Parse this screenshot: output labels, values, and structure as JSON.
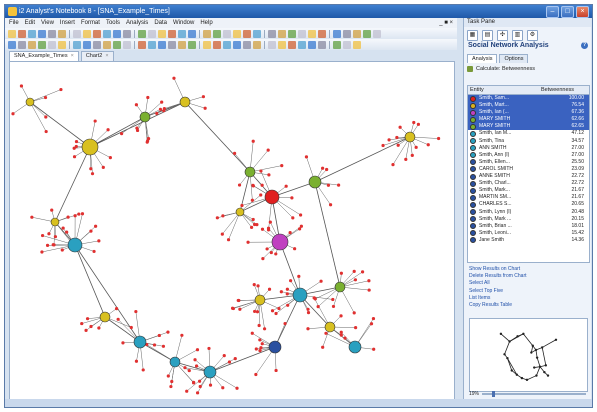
{
  "window": {
    "title": "i2 Analyst's Notebook 8 - [SNA_Example_Times]"
  },
  "menu": [
    "File",
    "Edit",
    "View",
    "Insert",
    "Format",
    "Tools",
    "Analysis",
    "Data",
    "Window",
    "Help"
  ],
  "tabs": [
    {
      "label": "SNA_Example_Times",
      "active": true
    },
    {
      "label": "Chart2",
      "active": false
    }
  ],
  "task_pane": {
    "title": "Task Pane",
    "heading": "Social Network Analysis",
    "tabs": [
      "Analysis",
      "Options"
    ],
    "calculate_label": "Calculate: Betweenness",
    "columns": {
      "entity": "Entity",
      "metric": "Betweenness"
    },
    "rows": [
      {
        "entity": "Smith, Sam...",
        "value": "100.00",
        "color": "#e02020",
        "selected": true
      },
      {
        "entity": "Smith, Mart...",
        "value": "76.54",
        "color": "#d8b020",
        "selected": true
      },
      {
        "entity": "Smith, Ian (...",
        "value": "67.36",
        "color": "#c040c0",
        "selected": true
      },
      {
        "entity": "MARY SMITH",
        "value": "62.66",
        "color": "#7ab030",
        "selected": true
      },
      {
        "entity": "MARY SMITH",
        "value": "62.65",
        "color": "#7ab030",
        "selected": true
      },
      {
        "entity": "Smith, Ian M...",
        "value": "47.12",
        "color": "#2aa0c0",
        "selected": false
      },
      {
        "entity": "Smith, Tina",
        "value": "34.57",
        "color": "#2aa0c0",
        "selected": false
      },
      {
        "entity": "ANN SMITH",
        "value": "27.00",
        "color": "#2aa0c0",
        "selected": false
      },
      {
        "entity": "Smith, Ann (I)",
        "value": "27.00",
        "color": "#2aa0c0",
        "selected": false
      },
      {
        "entity": "Smith, Ellen...",
        "value": "25.50",
        "color": "#2a50a0",
        "selected": false
      },
      {
        "entity": "CAROL SMITH",
        "value": "23.09",
        "color": "#2a50a0",
        "selected": false
      },
      {
        "entity": "ANNE SMITH",
        "value": "22.72",
        "color": "#2a50a0",
        "selected": false
      },
      {
        "entity": "Smith, Charl...",
        "value": "22.72",
        "color": "#2a50a0",
        "selected": false
      },
      {
        "entity": "Smith, Mark...",
        "value": "21.67",
        "color": "#2a50a0",
        "selected": false
      },
      {
        "entity": "MARTIN SM...",
        "value": "21.67",
        "color": "#2a50a0",
        "selected": false
      },
      {
        "entity": "CHARLES S...",
        "value": "20.65",
        "color": "#2a50a0",
        "selected": false
      },
      {
        "entity": "Smith, Lynn (I)",
        "value": "20.48",
        "color": "#2a50a0",
        "selected": false
      },
      {
        "entity": "Smith, Mark ...",
        "value": "20.15",
        "color": "#2a50a0",
        "selected": false
      },
      {
        "entity": "Smith, Brian ...",
        "value": "18.01",
        "color": "#2a50a0",
        "selected": false
      },
      {
        "entity": "Smith, Leoni...",
        "value": "15.42",
        "color": "#2a50a0",
        "selected": false
      },
      {
        "entity": "Jane Smith",
        "value": "14.36",
        "color": "#2a50a0",
        "selected": false
      }
    ],
    "actions": [
      "Show Results on Chart",
      "Delete Results from Chart",
      "Select All",
      "Select Top Five",
      "List Items",
      "Copy Results Table"
    ],
    "zoom": "19%"
  }
}
